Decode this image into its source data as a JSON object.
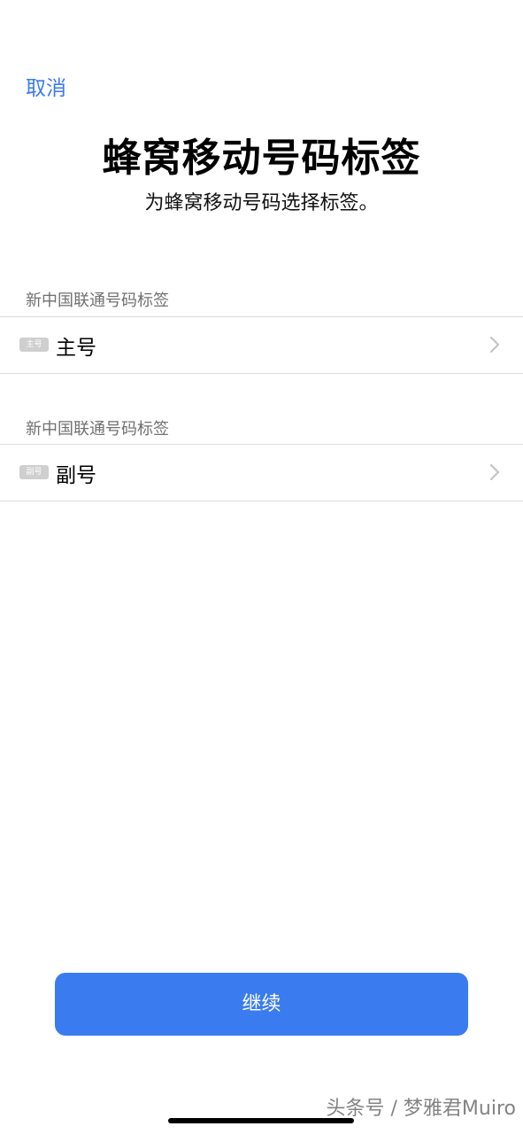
{
  "header": {
    "cancel_label": "取消",
    "title": "蜂窝移动号码标签",
    "subtitle": "为蜂窝移动号码选择标签。"
  },
  "lines": [
    {
      "section_label": "新中国联通号码标签",
      "badge": "主号",
      "label": "主号"
    },
    {
      "section_label": "新中国联通号码标签",
      "badge": "副号",
      "label": "副号"
    }
  ],
  "footer": {
    "continue_label": "继续"
  },
  "watermark": "头条号 / 梦雅君Muiro",
  "colors": {
    "accent": "#3a7cf0",
    "badge": "#cfcfcf",
    "separator": "#dcdcdc",
    "secondary_text": "#707070"
  },
  "icons": {
    "row_chevron": "chevron-right-icon"
  }
}
